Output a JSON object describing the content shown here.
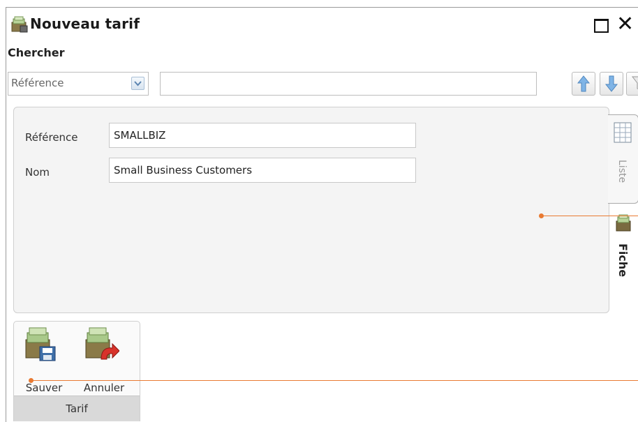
{
  "window": {
    "title": "Nouveau tarif"
  },
  "search": {
    "section_label": "Chercher",
    "combo_value": "Référence",
    "input_value": ""
  },
  "form": {
    "reference_label": "Référence",
    "reference_value": "SMALLBIZ",
    "name_label": "Nom",
    "name_value": "Small Business Customers"
  },
  "side_tabs": [
    {
      "label": "Liste",
      "active": false
    },
    {
      "label": "Fiche",
      "active": true
    }
  ],
  "actions": {
    "save_label": "Sauver",
    "cancel_label": "Annuler",
    "group_label": "Tarif"
  },
  "icons": {
    "window": "tariff-box-icon",
    "maximize": "maximize-icon",
    "close": "close-icon",
    "combo_dropdown": "chevron-down-icon",
    "up": "arrow-up-icon",
    "down": "arrow-down-icon",
    "filter": "filter-icon",
    "list": "grid-icon",
    "form": "tariff-box-icon",
    "save": "save-icon",
    "cancel": "undo-icon"
  },
  "colors": {
    "accent_callout": "#e97a32",
    "arrow_blue": "#6aa3d8",
    "panel_bg": "#f4f4f4"
  }
}
